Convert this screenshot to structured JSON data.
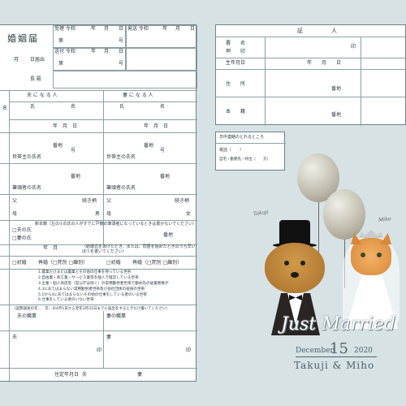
{
  "form": {
    "title": "婚姻届",
    "received_label": "受理 令和",
    "sent_label": "送付 令和",
    "issue_label": "発送 令和",
    "year": "年",
    "month": "月",
    "day": "日",
    "number_label": "第",
    "go": "号",
    "submitted_label": "日届出",
    "mayor": "長 殿",
    "husband_header": "夫 に な る 人",
    "wife_header": "妻 に な る 人",
    "name_label": "名",
    "surname": "氏",
    "given": "名",
    "birth_row": "年　月　日",
    "banchi": "番地",
    "gou": "号",
    "householder": "世帯主の氏名",
    "honseki_head": "筆頭者の氏名",
    "father": "父",
    "mother": "母",
    "relation_h": "続き柄",
    "relation_w": "続き柄",
    "male": "男",
    "female": "女",
    "new_honseki": "新本籍（左の①の氏の人がすでに戸籍の筆頭者になっているときは書かないでください）",
    "husband_surname_opt": "□夫の氏",
    "wife_surname_opt": "□妻の氏",
    "cohab_label": "年　月",
    "cohab_note": "（結婚式をあげたとき、または、同居を始めたときのうち早いほうを書いてください）",
    "first_marriage": "□初婚",
    "remarriage": "再婚（□死別 □離別）",
    "occupation_lines": [
      "1.農業だけまたは農業とその他の仕事を持っている世帯",
      "2.自由業・商工業・サービス業等を個人で経営している世帯",
      "3.企業・個人商店等（官公庁は除く）の常用勤労者世帯で勤め先の従業者数が",
      "4.3にあてはまらない常用勤労者世帯及び会社団体の役員の世帯",
      "5.1から4にあてはまらないその他の仕事をしている者のいる世帯",
      "6.仕事をしている者のいない世帯"
    ],
    "census_note": "（国勢調査の年…　年…の4月1日から翌年3月31日までに届出をするときだけ書いてください）",
    "husband_job": "夫の職業",
    "wife_job": "妻の職業",
    "signer_h": "夫",
    "signer_w": "妻",
    "seal": "印",
    "footer_tel": "住定年月日",
    "footer_h": "夫",
    "footer_w": "妻"
  },
  "witness": {
    "header": "証　　　　　人",
    "signature": "署　　名",
    "seal": "押　　印",
    "dob": "生年月日",
    "year_month_day": "年　　月　　日",
    "address": "住　　所",
    "honseki": "本　　籍",
    "banchi": "番地",
    "gou": "番",
    "seal_mark": "印"
  },
  "contact": {
    "title": "日中連絡のとれるところ",
    "tel_label": "電話（　　）",
    "home": "自宅・勤務先・呼出（　　方）"
  },
  "illustration": {
    "groom_name": "Takuji",
    "bride_name": "Miho",
    "groom_script": "Takuji Miho",
    "bride_script": "Takuji Miho",
    "headline": "Just Married",
    "month": "December",
    "day": "15",
    "year": "2020",
    "names_line": "Takuji & Miho"
  },
  "colors": {
    "background": "#d6e2e4",
    "ink": "#2a3a3f",
    "panel": "#ffffff",
    "balloon": "#bdb9aa"
  }
}
